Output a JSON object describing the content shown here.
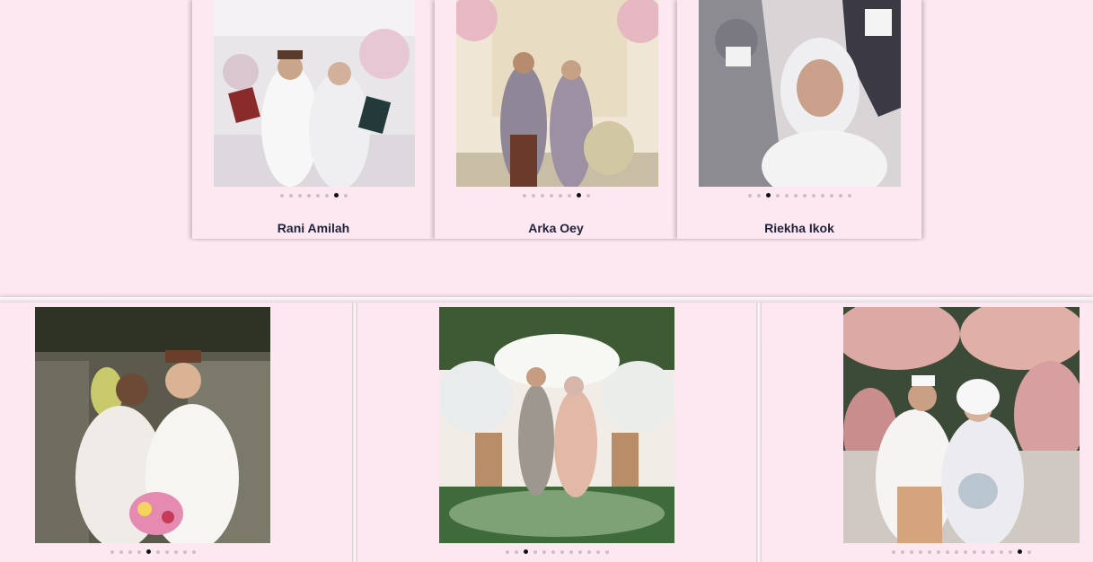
{
  "top_cards": [
    {
      "name": "Rani Amilah",
      "dots": 8,
      "active": 6
    },
    {
      "name": "Arka Oey",
      "dots": 8,
      "active": 6
    },
    {
      "name": "Riekha Ikok",
      "dots": 12,
      "active": 2
    }
  ],
  "bottom_cards": [
    {
      "dots": 10,
      "active": 4
    },
    {
      "dots": 12,
      "active": 2
    },
    {
      "dots": 16,
      "active": 14
    }
  ],
  "colors": {
    "background": "#fde7f0",
    "name_text": "#1f2238",
    "dot_inactive": "#c9bfc4",
    "dot_active": "#111111"
  }
}
